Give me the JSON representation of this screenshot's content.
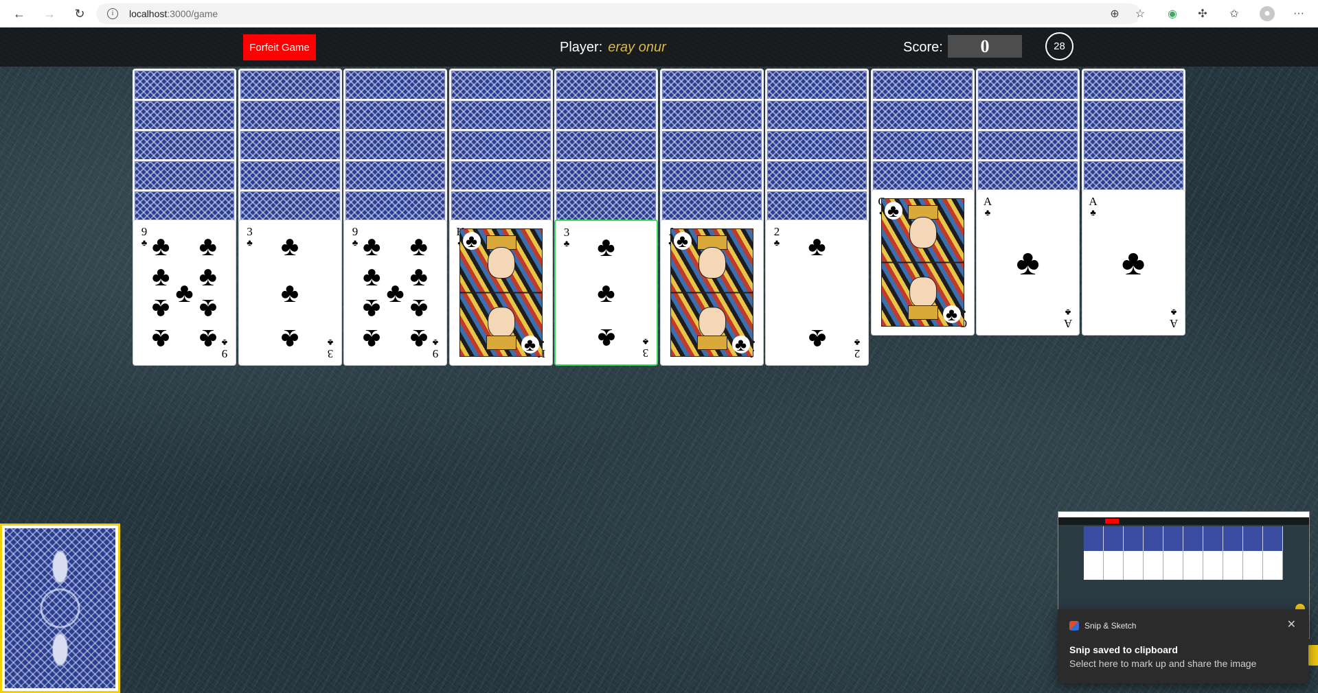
{
  "browser": {
    "url_host": "localhost",
    "url_rest": ":3000/game",
    "back_icon": "←",
    "forward_icon": "→",
    "reload_icon": "↻"
  },
  "header": {
    "forfeit_label": "Forfeit Game",
    "player_label": "Player:",
    "player_name": "eray onur",
    "score_label": "Score:",
    "score_value": "0",
    "timer_value": "28"
  },
  "tableau": [
    {
      "backs": 5,
      "face": {
        "rank": "9",
        "suit": "♣",
        "type": "pips"
      }
    },
    {
      "backs": 5,
      "face": {
        "rank": "3",
        "suit": "♣",
        "type": "pips"
      }
    },
    {
      "backs": 5,
      "face": {
        "rank": "9",
        "suit": "♣",
        "type": "pips"
      }
    },
    {
      "backs": 5,
      "face": {
        "rank": "K",
        "suit": "♣",
        "type": "court"
      }
    },
    {
      "backs": 5,
      "face": {
        "rank": "3",
        "suit": "♣",
        "type": "pips",
        "selected": true
      }
    },
    {
      "backs": 5,
      "face": {
        "rank": "J",
        "suit": "♣",
        "type": "court"
      }
    },
    {
      "backs": 5,
      "face": {
        "rank": "2",
        "suit": "♣",
        "type": "pips"
      }
    },
    {
      "backs": 4,
      "face": {
        "rank": "Q",
        "suit": "♣",
        "type": "court"
      }
    },
    {
      "backs": 4,
      "face": {
        "rank": "A",
        "suit": "♣",
        "type": "pips"
      }
    },
    {
      "backs": 4,
      "face": {
        "rank": "A",
        "suit": "♣",
        "type": "pips"
      }
    }
  ],
  "toast": {
    "app_name": "Snip & Sketch",
    "title": "Snip saved to clipboard",
    "body": "Select here to mark up and share the image",
    "close_icon": "✕"
  }
}
